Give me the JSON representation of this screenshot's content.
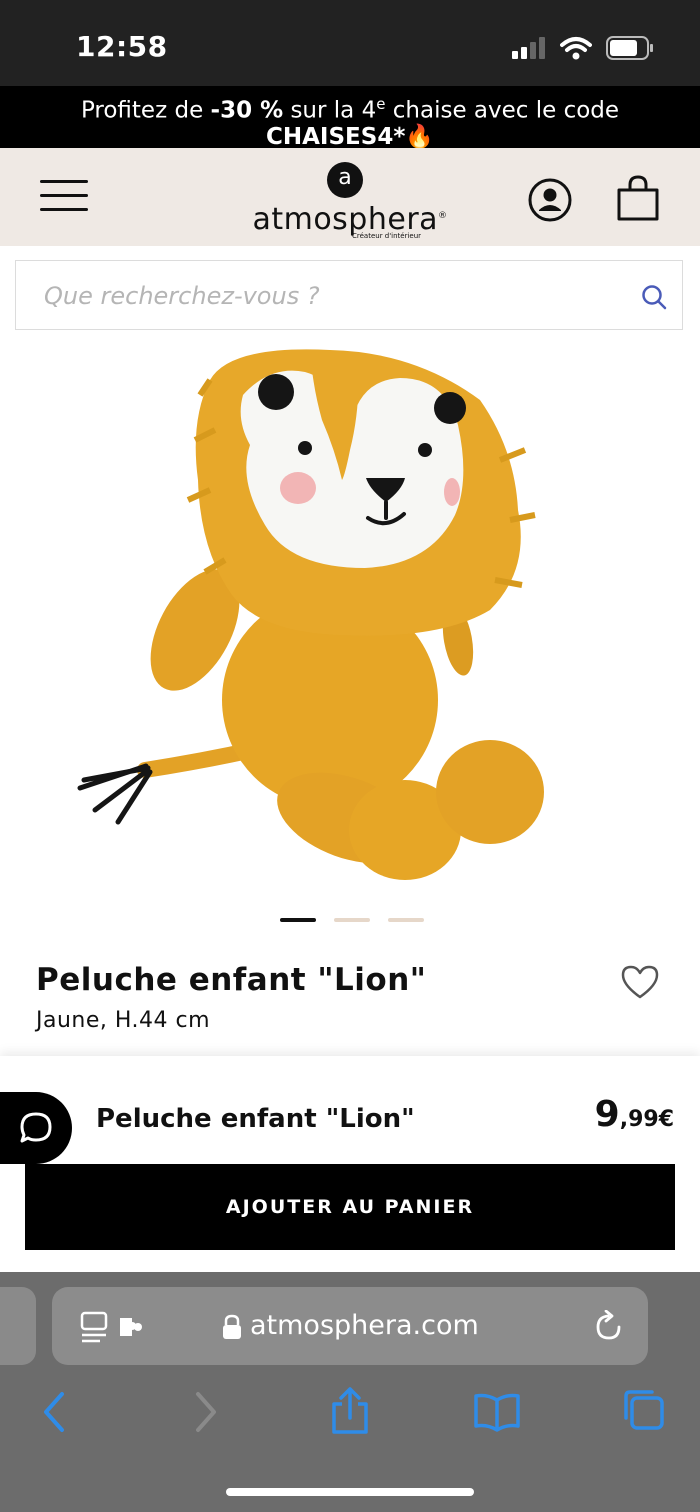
{
  "status_bar": {
    "time": "12:58"
  },
  "promo": {
    "text_before": "Profitez de ",
    "discount": "-30 %",
    "text_middle": " sur la 4",
    "superscript": "e",
    "text_after": " chaise avec le code",
    "code": "CHAISES4*",
    "emoji": "🔥"
  },
  "header": {
    "logo_letter": "a",
    "logo_text": "atmosphera",
    "logo_mark": "®",
    "logo_tagline": "Créateur d'intérieur"
  },
  "search": {
    "placeholder": "Que recherchez-vous ?"
  },
  "product": {
    "title": "Peluche enfant \"Lion\"",
    "subtitle": "Jaune, H.44 cm",
    "image_colors": {
      "body": "#e6a626",
      "face": "#f7f7f4",
      "cheek": "#f2b5b5",
      "dark": "#151515"
    }
  },
  "carousel": {
    "count": 3,
    "active": 0
  },
  "sticky_bar": {
    "title": "Peluche enfant \"Lion\"",
    "price_int": "9",
    "price_dec": ",99€",
    "cta": "AJOUTER AU PANIER"
  },
  "browser": {
    "url": "atmosphera.com"
  },
  "colors": {
    "header_bg": "#efe9e4",
    "accent": "#000000",
    "dot_inactive": "#e6d7c9",
    "safari_bg": "#6c6c6c",
    "safari_icon": "#2f8ce8"
  }
}
